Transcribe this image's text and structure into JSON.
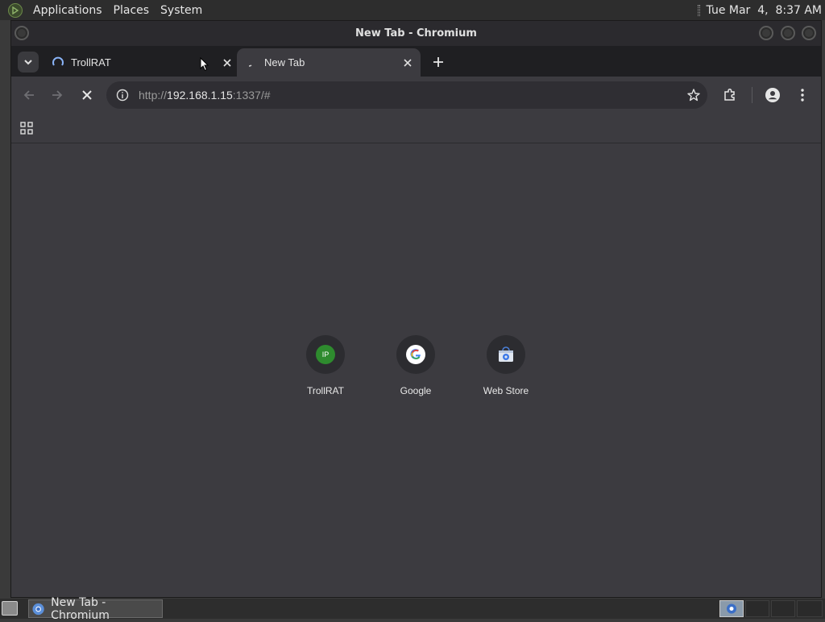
{
  "top_panel": {
    "menus": [
      "Applications",
      "Places",
      "System"
    ],
    "clock": "Tue Mar  4,  8:37 AM"
  },
  "window": {
    "title": "New Tab - Chromium"
  },
  "tabs": [
    {
      "label": "TrollRAT",
      "state": "loading"
    },
    {
      "label": "New Tab",
      "state": "active"
    }
  ],
  "toolbar": {
    "url_scheme": "http://",
    "url_host": "192.168.1.15",
    "url_rest": ":1337/#"
  },
  "shortcuts": [
    {
      "label": "TrollRAT",
      "icon": "ip-favicon-icon",
      "badge": "IP"
    },
    {
      "label": "Google",
      "icon": "google-g-icon"
    },
    {
      "label": "Web Store",
      "icon": "web-store-icon"
    }
  ],
  "taskbar": {
    "task_label": "New Tab - Chromium"
  },
  "colors": {
    "accent_green": "#2e8b2e",
    "page_bg": "#3c3b40"
  }
}
